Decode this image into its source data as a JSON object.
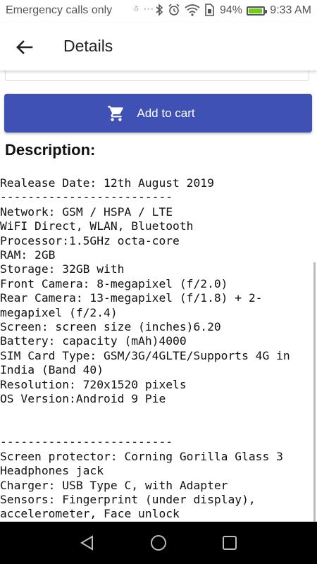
{
  "status_bar": {
    "carrier": "Emergency calls only",
    "battery": "94%",
    "battery_level": 0.94,
    "time": "9:33 AM",
    "icons": [
      "accessibility-icon",
      "more-icon",
      "bluetooth-icon",
      "alarm-icon",
      "wifi-icon",
      "sim-icon",
      "battery-icon"
    ]
  },
  "app_bar": {
    "back_icon": "back-arrow-icon",
    "title": "Details"
  },
  "actions": {
    "add_to_cart": "Add to cart",
    "cart_icon": "cart-icon",
    "button_color": "#3f51b5"
  },
  "description": {
    "heading": "Description:",
    "text": "Realease Date: 12th August 2019\n-------------------------\nNetwork: GSM / HSPA / LTE\nWiFI Direct, WLAN, Bluetooth\nProcessor:1.5GHz octa-core\nRAM: 2GB\nStorage: 32GB with\nFront Camera: 8-megapixel (f/2.0)\nRear Camera: 13-megapixel (f/1.8) + 2-megapixel (f/2.4)\nScreen: screen size (inches)6.20\nBattery: capacity (mAh)4000\nSIM Card Type: GSM/3G/4GLTE/Supports 4G in India (Band 40)\nResolution: 720x1520 pixels\nOS Version:Android 9 Pie\n\n\n-------------------------\nScreen protector: Corning Gorilla Glass 3\nHeadphones jack\nCharger: USB Type C, with Adapter\nSensors: Fingerprint (under display), accelerometer, Face unlock"
  },
  "nav_bar": {
    "icons": [
      "back-triangle-icon",
      "home-circle-icon",
      "recents-square-icon"
    ]
  }
}
